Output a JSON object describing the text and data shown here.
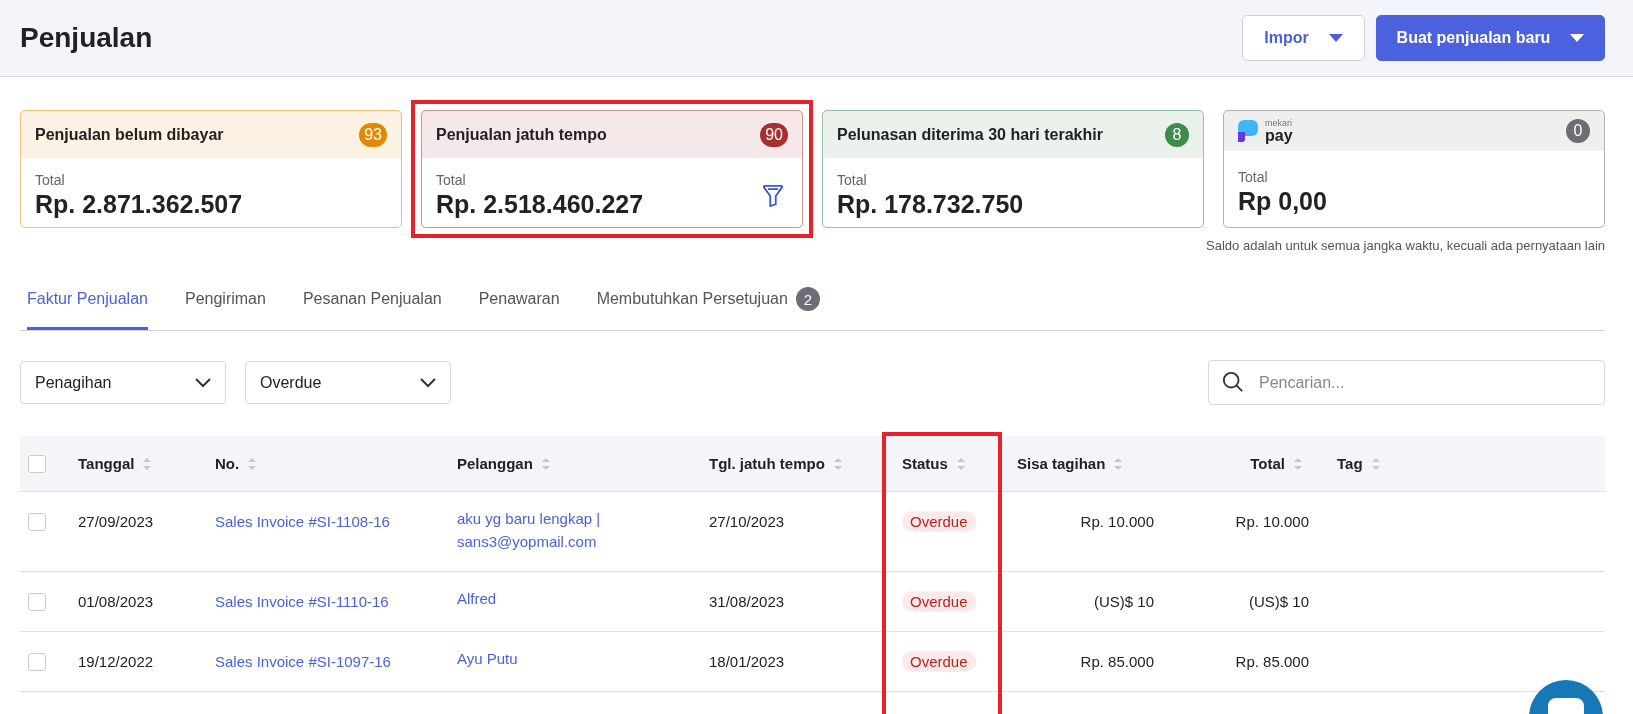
{
  "page": {
    "title": "Penjualan",
    "buttons": [
      {
        "label": "Impor",
        "kind": "secondary"
      },
      {
        "label": "Buat penjualan baru",
        "kind": "primary"
      }
    ]
  },
  "summary_cards": [
    {
      "kind": "count",
      "title": "Penjualan belum dibayar",
      "count": "93",
      "color": "#e08a00",
      "total_label": "Total",
      "total": "Rp. 2.871.362.507",
      "filter": false,
      "highlighted": false
    },
    {
      "kind": "count",
      "title": "Penjualan jatuh tempo",
      "count": "90",
      "color": "#a82f2f",
      "total_label": "Total",
      "total": "Rp. 2.518.460.227",
      "filter": true,
      "highlighted": true
    },
    {
      "kind": "count",
      "title": "Pelunasan diterima 30 hari terakhir",
      "count": "8",
      "color": "#3d8c4a",
      "total_label": "Total",
      "total": "Rp. 178.732.750",
      "filter": false,
      "highlighted": false
    },
    {
      "kind": "brand",
      "brand_small": "mekari",
      "brand_large": "pay",
      "count": "0",
      "color": "#6b6e75",
      "total_label": "Total",
      "total": "Rp 0,00",
      "filter": false,
      "highlighted": false
    }
  ],
  "balance_note": "Saldo adalah untuk semua jangka waktu, kecuali ada pernyataan lain",
  "tabs": [
    {
      "label": "Faktur Penjualan",
      "selected": true
    },
    {
      "label": "Pengiriman",
      "selected": false
    },
    {
      "label": "Pesanan Penjualan",
      "selected": false
    },
    {
      "label": "Penawaran",
      "selected": false
    },
    {
      "label": "Membutuhkan Persetujuan",
      "selected": false,
      "badge": "2"
    }
  ],
  "filters": [
    {
      "value": "Penagihan"
    },
    {
      "value": "Overdue"
    }
  ],
  "search": {
    "placeholder": "Pencarian..."
  },
  "table": {
    "all_checked": false,
    "columns": [
      {
        "label": "Tanggal",
        "highlighted": false
      },
      {
        "label": "No.",
        "highlighted": false
      },
      {
        "label": "Pelanggan",
        "highlighted": false
      },
      {
        "label": "Tgl. jatuh tempo",
        "highlighted": false
      },
      {
        "label": "Status",
        "highlighted": true
      },
      {
        "label": "Sisa tagihan",
        "highlighted": false
      },
      {
        "label": "Total",
        "highlighted": false
      },
      {
        "label": "Tag",
        "highlighted": false
      }
    ],
    "rows": [
      {
        "checked": false,
        "date": "27/09/2023",
        "number": "Sales Invoice #SI-1108-16",
        "customer": "aku yg baru lengkap | sans3@yopmail.com",
        "due": "27/10/2023",
        "status": "Overdue",
        "remaining": "Rp. 10.000",
        "total": "Rp. 10.000"
      },
      {
        "checked": false,
        "date": "01/08/2023",
        "number": "Sales Invoice #SI-1110-16",
        "customer": "Alfred",
        "due": "31/08/2023",
        "status": "Overdue",
        "remaining": "(US)$ 10",
        "total": "(US)$ 10"
      },
      {
        "checked": false,
        "date": "19/12/2022",
        "number": "Sales Invoice #SI-1097-16",
        "customer": "Ayu Putu",
        "due": "18/01/2023",
        "status": "Overdue",
        "remaining": "Rp. 85.000",
        "total": "Rp. 85.000"
      }
    ]
  }
}
